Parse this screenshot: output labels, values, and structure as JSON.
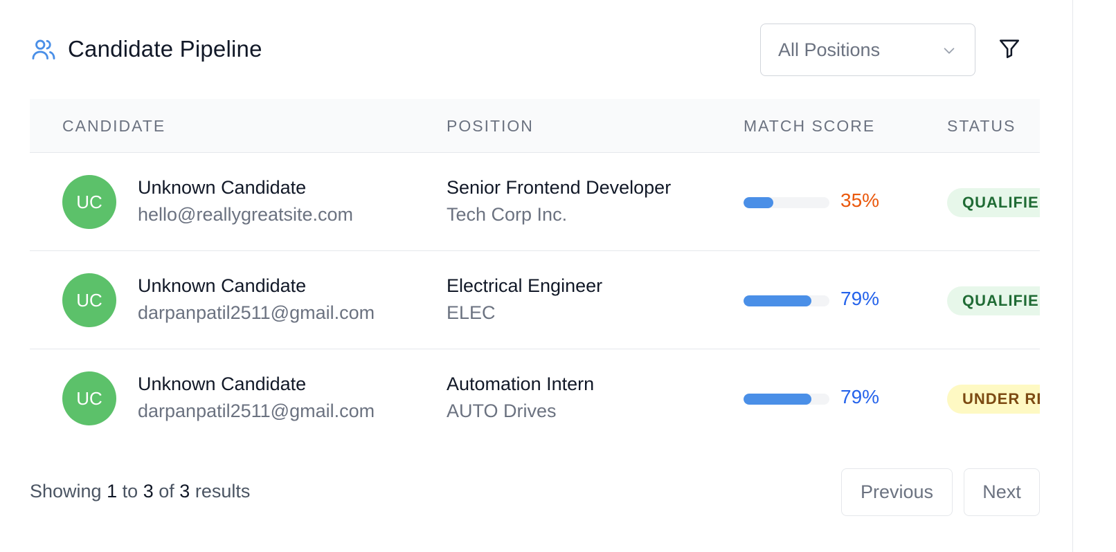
{
  "header": {
    "title": "Candidate Pipeline",
    "title_icon": "users-icon",
    "position_filter": {
      "selected": "All Positions",
      "icon": "chevron-down-icon"
    },
    "filter_icon": "filter-icon"
  },
  "table": {
    "columns": [
      "CANDIDATE",
      "POSITION",
      "MATCH SCORE",
      "STATUS"
    ],
    "rows": [
      {
        "initials": "UC",
        "name": "Unknown Candidate",
        "email": "hello@reallygreatsite.com",
        "position": "Senior Frontend Developer",
        "company": "Tech Corp Inc.",
        "match_score": "35%",
        "match_fraction": 0.35,
        "score_color": "#ea580c",
        "status": "QUALIFIED",
        "status_bg": "#e7f7ea",
        "status_color": "#1f6b34"
      },
      {
        "initials": "UC",
        "name": "Unknown Candidate",
        "email": "darpanpatil2511@gmail.com",
        "position": "Electrical Engineer",
        "company": "ELEC",
        "match_score": "79%",
        "match_fraction": 0.79,
        "score_color": "#2563eb",
        "status": "QUALIFIED",
        "status_bg": "#e7f7ea",
        "status_color": "#1f6b34"
      },
      {
        "initials": "UC",
        "name": "Unknown Candidate",
        "email": "darpanpatil2511@gmail.com",
        "position": "Automation Intern",
        "company": "AUTO Drives",
        "match_score": "79%",
        "match_fraction": 0.79,
        "score_color": "#2563eb",
        "status": "UNDER REVIEW",
        "status_bg": "#fef9c3",
        "status_color": "#7c4a12"
      }
    ]
  },
  "footer": {
    "showing_prefix": "Showing",
    "from": "1",
    "to_word": "to",
    "to": "3",
    "of_word": "of",
    "total": "3",
    "suffix": "results",
    "previous_label": "Previous",
    "next_label": "Next"
  },
  "colors": {
    "accent": "#4a8fe7",
    "avatar_bg": "#5cc16a"
  }
}
